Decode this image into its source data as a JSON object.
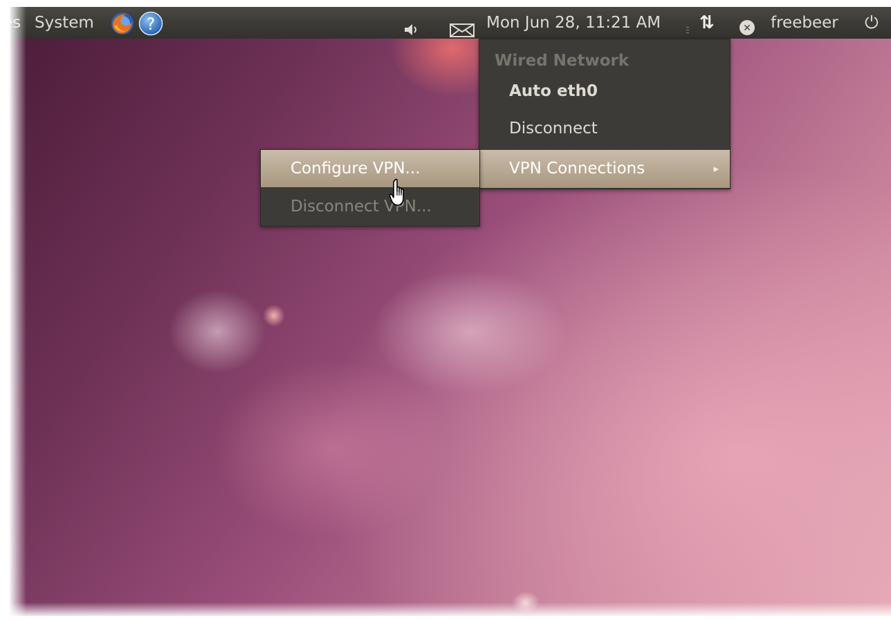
{
  "panel": {
    "places_fragment": "es",
    "system_menu": "System",
    "firefox_icon": "firefox-icon",
    "help_icon": "help-icon",
    "help_glyph": "?",
    "volume_icon": "volume-icon",
    "mail_icon": "mail-icon",
    "clock": "Mon Jun 28, 11:21 AM",
    "network_icon": "network-updown-icon",
    "network_glyph": "⇅",
    "user_status_icon": "user-status-offline-icon",
    "user_status_glyph": "✕",
    "username": "freebeer",
    "power_icon": "power-icon",
    "power_glyph": "⏻"
  },
  "network_menu": {
    "header": "Wired Network",
    "connection": "Auto eth0",
    "disconnect": "Disconnect",
    "vpn_connections": "VPN Connections",
    "submenu_arrow": "▸"
  },
  "vpn_submenu": {
    "configure": "Configure VPN...",
    "disconnect": "Disconnect VPN..."
  },
  "colors": {
    "panel": "#3d3b36",
    "menu_bg": "#3c3b37",
    "menu_highlight": "#b4a58f",
    "text": "#dfdbd2",
    "disabled_text": "#8a867d"
  }
}
